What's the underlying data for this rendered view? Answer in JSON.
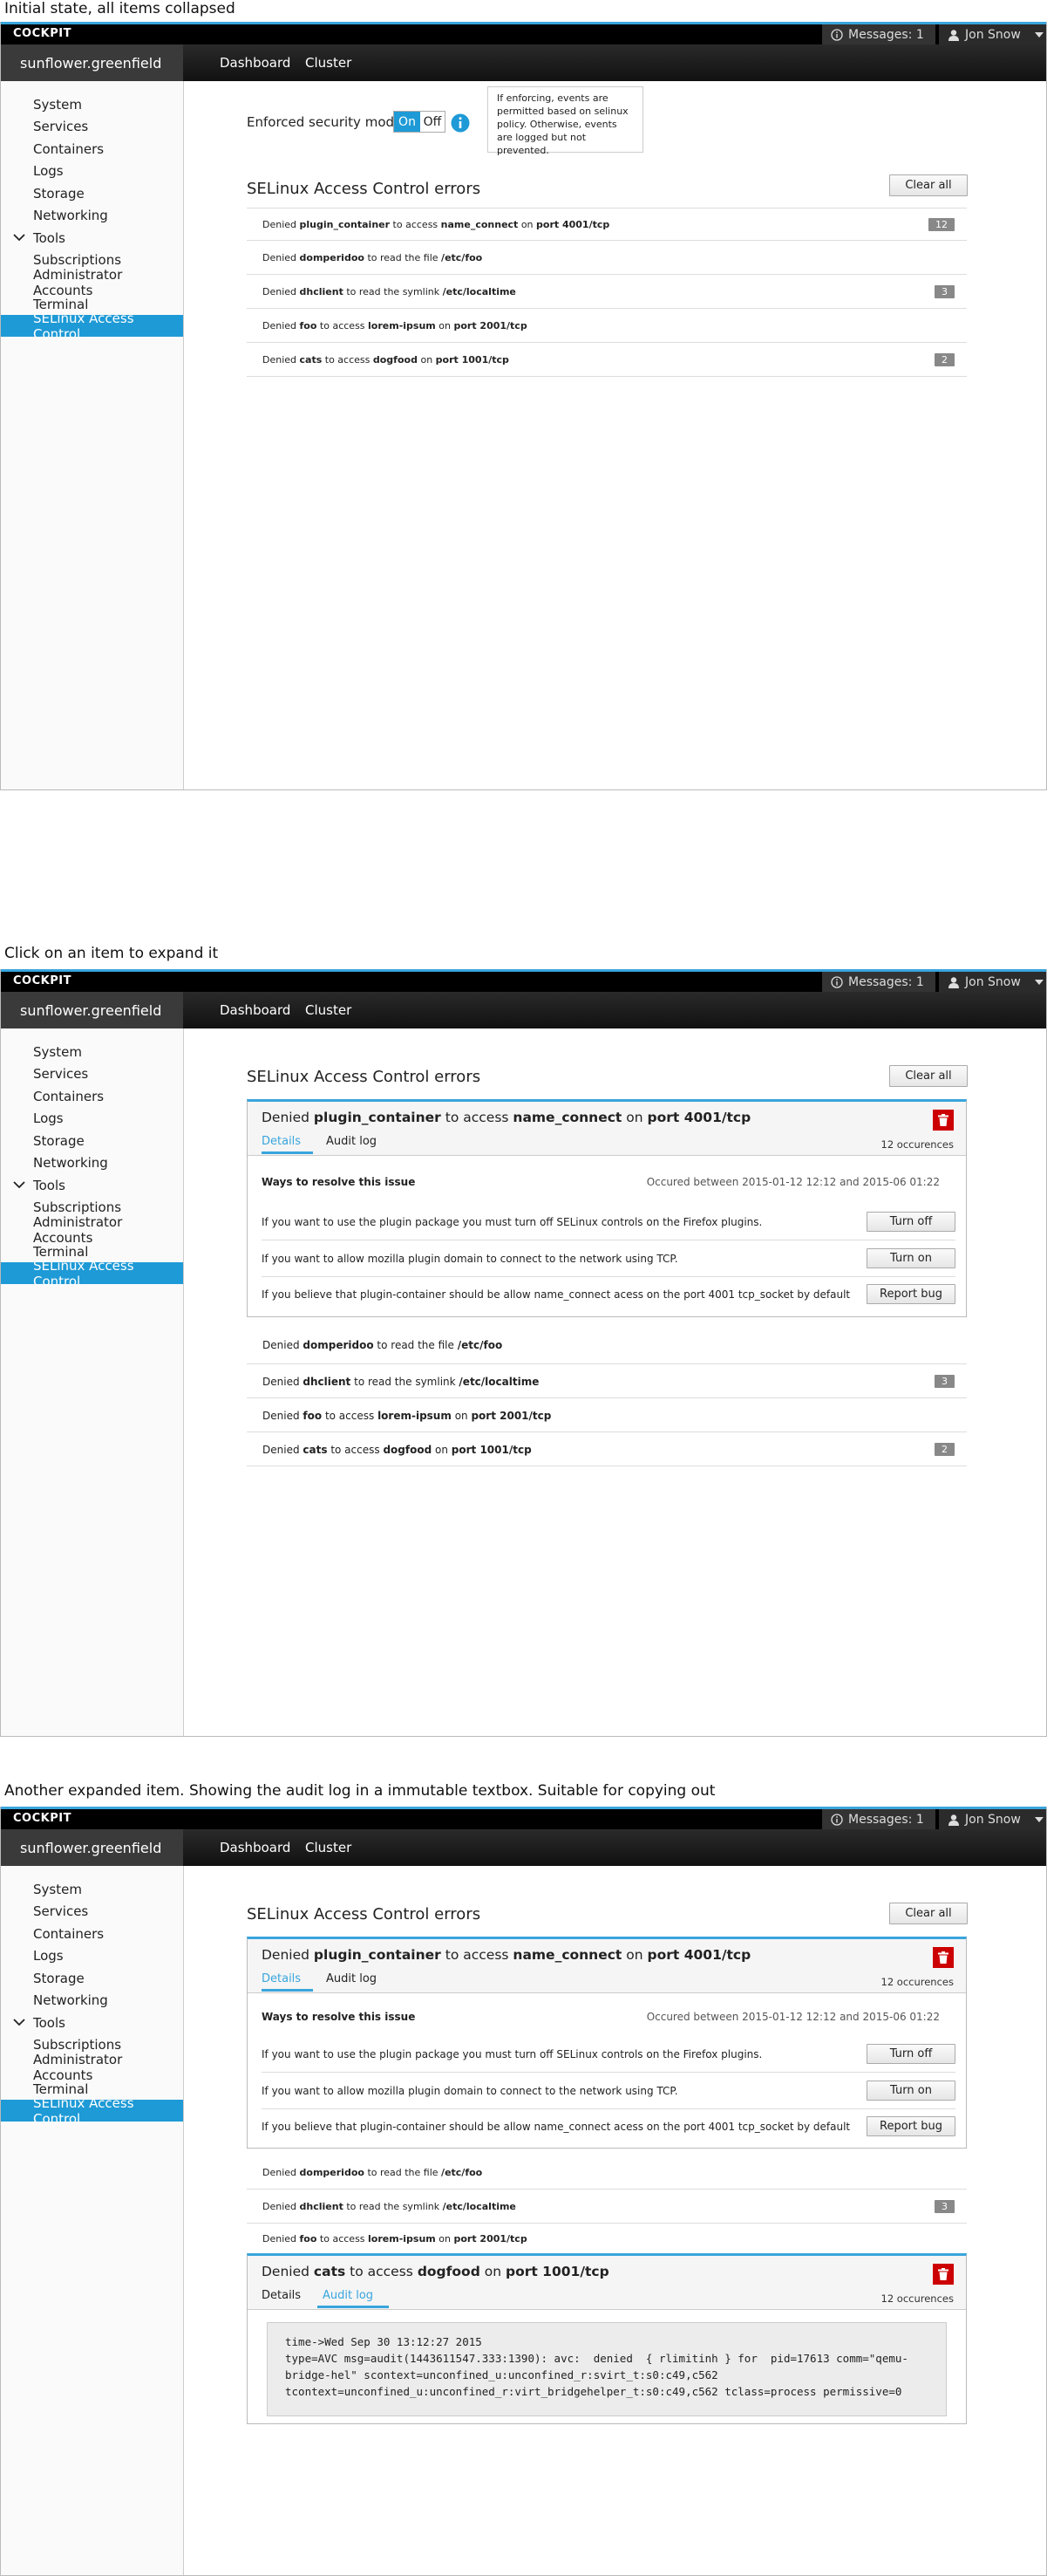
{
  "captions": {
    "s1": "Initial state, all items collapsed",
    "s2": "Click on an item to expand it",
    "s3": "Another expanded item. Showing the audit log in a immutable textbox. Suitable for copying out"
  },
  "app": {
    "brand": "COCKPIT",
    "messages": "Messages: 1",
    "user": "Jon Snow",
    "host": "sunflower.greenfield"
  },
  "nav": {
    "dashboard": "Dashboard",
    "cluster": "Cluster"
  },
  "sidebar": [
    "System",
    "Services",
    "Containers",
    "Logs",
    "Storage",
    "Networking",
    "Tools",
    "Subscriptions",
    "Administrator Accounts",
    "Terminal",
    "SELinux Access Control"
  ],
  "mode": {
    "label": "Enforced security mode",
    "on": "On",
    "off": "Off",
    "tip": "If enforcing, events are permitted based on selinux policy. Otherwise, events are logged but not prevented."
  },
  "errors_title": "SELinux Access Control  errors",
  "clear_all": "Clear all",
  "w": {
    "denied": "Denied",
    "to_access": "to access",
    "to_read_file": "to read the file",
    "to_read_symlink": "to read the symlink",
    "on": "on"
  },
  "items": [
    {
      "subject": "plugin_container",
      "object": "name_connect",
      "port": "port 4001/tcp",
      "count": "12"
    },
    {
      "subject": "domperidoo",
      "object": "/etc/foo"
    },
    {
      "subject": "dhclient",
      "object": "/etc/localtime",
      "count": "3"
    },
    {
      "subject": "foo",
      "object": "lorem-ipsum",
      "port": "port 2001/tcp"
    },
    {
      "subject": "cats",
      "object": "dogfood",
      "port": "port 1001/tcp",
      "count": "2"
    }
  ],
  "detail": {
    "tab_details": "Details",
    "tab_audit": "Audit log",
    "occurrences": "12 occurences",
    "ways": "Ways to resolve this issue",
    "occurred": "Occured between 2015-01-12 12:12 and 2015-06 01:22",
    "fixes": [
      {
        "text": "If you want to use the plugin package you must turn off SELinux controls on the Firefox plugins.",
        "button": "Turn off"
      },
      {
        "text": "If you want to allow mozilla plugin domain to connect to the network using TCP.",
        "button": "Turn on"
      },
      {
        "text": "If you believe that plugin-container should be allow name_connect acess on the port 4001 tcp_socket by default",
        "button": "Report bug"
      }
    ],
    "audit_log": "time->Wed Sep 30 13:12:27 2015\ntype=AVC msg=audit(1443611547.333:1390): avc:  denied  { rlimitinh } for  pid=17613 comm=\"qemu-bridge-hel\" scontext=unconfined_u:unconfined_r:svirt_t:s0:c49,c562 tcontext=unconfined_u:unconfined_r:virt_bridgehelper_t:s0:c49,c562 tclass=process permissive=0"
  },
  "colors": {
    "accent": "#39a5dc",
    "sidebar_active": "#1e9ad6",
    "delete": "#cc0000"
  }
}
